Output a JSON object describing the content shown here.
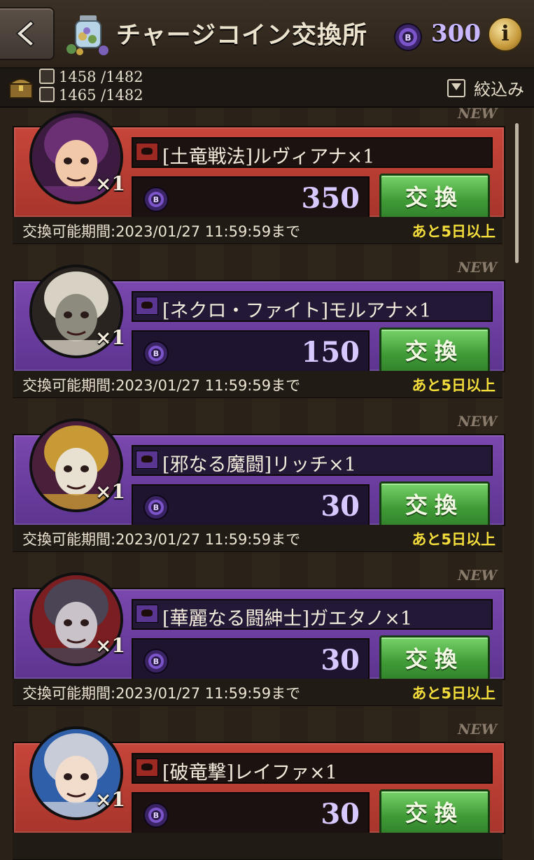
{
  "header": {
    "title": "チャージコイン交換所",
    "coin_amount": "300",
    "info_label": "i"
  },
  "subbar": {
    "counter_1": "1458 /1482",
    "counter_2": "1465 /1482",
    "filter_label": "絞込み"
  },
  "items": [
    {
      "badge": "NEW",
      "name": "[土竜戦法]ルヴィアナ×1",
      "price": "350",
      "button": "交換",
      "qty": "×1",
      "period": "交換可能期間:2023/01/27 11:59:59まで",
      "remaining": "あと5日以上",
      "theme": "red",
      "avatar_colors": [
        "#6b2f74",
        "#f1c9a8",
        "#3b1b40"
      ]
    },
    {
      "badge": "NEW",
      "name": "[ネクロ・ファイト]モルアナ×1",
      "price": "150",
      "button": "交換",
      "qty": "×1",
      "period": "交換可能期間:2023/01/27 11:59:59まで",
      "remaining": "あと5日以上",
      "theme": "purple",
      "avatar_colors": [
        "#d8d2c4",
        "#8d8a7e",
        "#2a2420"
      ]
    },
    {
      "badge": "NEW",
      "name": "[邪なる魔闘]リッチ×1",
      "price": "30",
      "button": "交換",
      "qty": "×1",
      "period": "交換可能期間:2023/01/27 11:59:59まで",
      "remaining": "あと5日以上",
      "theme": "purple",
      "avatar_colors": [
        "#c79a36",
        "#e8e0d0",
        "#4a1f3a"
      ]
    },
    {
      "badge": "NEW",
      "name": "[華麗なる闘紳士]ガエタノ×1",
      "price": "30",
      "button": "交換",
      "qty": "×1",
      "period": "交換可能期間:2023/01/27 11:59:59まで",
      "remaining": "あと5日以上",
      "theme": "purple",
      "avatar_colors": [
        "#4a4454",
        "#c9c2c8",
        "#7a1e22"
      ]
    },
    {
      "badge": "NEW",
      "name": "[破竜撃]レイファ×1",
      "price": "30",
      "button": "交換",
      "qty": "×1",
      "period": "",
      "remaining": "",
      "theme": "red",
      "avatar_colors": [
        "#c8ccd8",
        "#f2dccb",
        "#2f5fa8"
      ]
    }
  ]
}
